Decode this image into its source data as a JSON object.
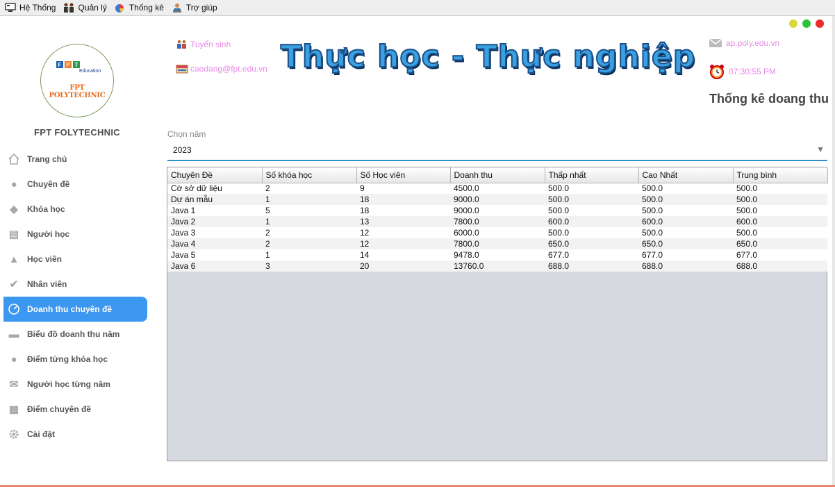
{
  "menubar": {
    "items": [
      {
        "label": "Hệ Thống",
        "icon": "system-icon"
      },
      {
        "label": "Quản lý",
        "icon": "management-icon"
      },
      {
        "label": "Thống kê",
        "icon": "statistics-icon"
      },
      {
        "label": "Trợ giúp",
        "icon": "help-icon"
      }
    ]
  },
  "window_controls": {
    "colors": [
      "#d8d83a",
      "#2fc13c",
      "#ec2c2c"
    ]
  },
  "sidebar": {
    "logo_text": "FPT POLYTECHNIC",
    "logo_sub": "Education",
    "logo_letters": [
      "F",
      "P",
      "T"
    ],
    "logo_colors": [
      "#1c63b5",
      "#e8802a",
      "#2b9a48"
    ],
    "brand": "FPT FOLYTECHNIC",
    "items": [
      {
        "label": "Trang chủ",
        "icon": "home-icon",
        "active": false
      },
      {
        "label": "Chuyên đề",
        "icon": "user-icon",
        "active": false
      },
      {
        "label": "Khóa học",
        "icon": "tag-icon",
        "active": false
      },
      {
        "label": "Người học",
        "icon": "books-icon",
        "active": false
      },
      {
        "label": "Học viên",
        "icon": "chart-line-icon",
        "active": false
      },
      {
        "label": "Nhân viên",
        "icon": "user-check-icon",
        "active": false
      },
      {
        "label": "Doanh thu chuyên đề",
        "icon": "gauge-icon",
        "active": true
      },
      {
        "label": "Biểu đồ doanh thu năm",
        "icon": "money-icon",
        "active": false
      },
      {
        "label": "Điểm từng khóa học",
        "icon": "moneybag-icon",
        "active": false
      },
      {
        "label": "Người học từng năm",
        "icon": "mail-icon",
        "active": false
      },
      {
        "label": "Điểm chuyên đề",
        "icon": "layers-icon",
        "active": false
      },
      {
        "label": "Cài đặt",
        "icon": "gear-icon",
        "active": false
      }
    ]
  },
  "header": {
    "admissions": "Tuyển sinh",
    "email": "caodang@fpt.edu.vn",
    "slogan": "Thực học - Thực nghiệp",
    "website": "ap.poly.edu.vn",
    "clock": "07:30:55 PM",
    "page_title": "Thống kê doang thu"
  },
  "filter": {
    "label": "Chọn năm",
    "value": "2023"
  },
  "table": {
    "headers": [
      "Chuyên Đề",
      "Số khóa học",
      "Số Học viên",
      "Doanh thu",
      "Thấp nhất",
      "Cao Nhất",
      "Trung bình"
    ],
    "rows": [
      [
        "Cờ sở dữ liệu",
        "2",
        "9",
        "4500.0",
        "500.0",
        "500.0",
        "500.0"
      ],
      [
        "Dự án mẫu",
        "1",
        "18",
        "9000.0",
        "500.0",
        "500.0",
        "500.0"
      ],
      [
        "Java 1",
        "5",
        "18",
        "9000.0",
        "500.0",
        "500.0",
        "500.0"
      ],
      [
        "Java 2",
        "1",
        "13",
        "7800.0",
        "600.0",
        "600.0",
        "600.0"
      ],
      [
        "Java 3",
        "2",
        "12",
        "6000.0",
        "500.0",
        "500.0",
        "500.0"
      ],
      [
        "Java 4",
        "2",
        "12",
        "7800.0",
        "650.0",
        "650.0",
        "650.0"
      ],
      [
        "Java 5",
        "1",
        "14",
        "9478.0",
        "677.0",
        "677.0",
        "677.0"
      ],
      [
        "Java 6",
        "3",
        "20",
        "13760.0",
        "688.0",
        "688.0",
        "688.0"
      ]
    ]
  }
}
